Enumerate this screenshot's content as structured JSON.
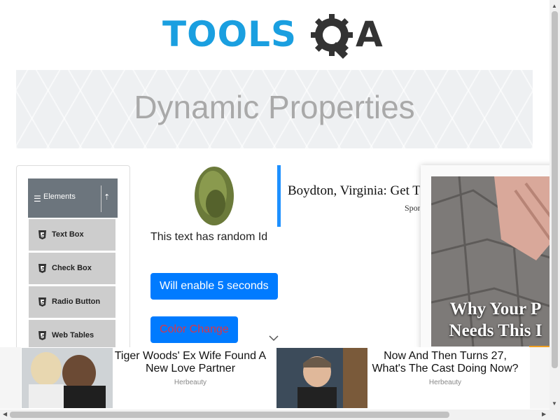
{
  "logo": {
    "text_tools": "TOOLS",
    "text_a": "A",
    "alt": "ToolsQA"
  },
  "page": {
    "title": "Dynamic Properties"
  },
  "sidebar": {
    "group": {
      "label": "Elements",
      "icon": "hamburger-icon"
    },
    "items": [
      {
        "label": "Text Box",
        "icon": "html5-icon"
      },
      {
        "label": "Check Box",
        "icon": "html5-icon"
      },
      {
        "label": "Radio Button",
        "icon": "html5-icon"
      },
      {
        "label": "Web Tables",
        "icon": "html5-icon"
      }
    ]
  },
  "content": {
    "random_text": "This text has random Id",
    "enable_button": "Will enable 5 seconds",
    "color_button": "Color Change"
  },
  "ads": {
    "top_headline": "Boydton, Virginia: Get T",
    "top_sponsor": "Sponsored",
    "side_text_line1": "Why Your P",
    "side_text_line2": "Needs This I",
    "bottom": [
      {
        "headline": "Tiger Woods' Ex Wife Found A New Love Partner",
        "source": "Herbeauty"
      },
      {
        "headline": "Now And Then Turns 27, What's The Cast Doing Now?",
        "source": "Herbeauty"
      }
    ]
  },
  "colors": {
    "accent": "#007bff",
    "color_change_text": "#dc3545",
    "logo_blue": "#1a9fe0",
    "sidebar_header": "#6c757d"
  }
}
